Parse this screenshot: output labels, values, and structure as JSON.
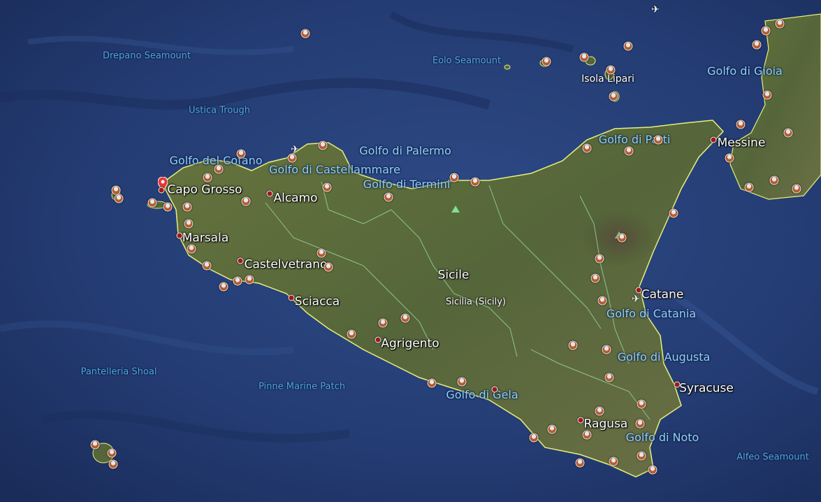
{
  "map": {
    "colors": {
      "sea": "#23386b",
      "land": "#5a6a38",
      "coast_line": "#e8f07a",
      "border_line": "#9ee3a8",
      "water_label": "#4fa9e8",
      "gulf_label": "#8fd2ff"
    },
    "labels": {
      "drepano_seamount": "Drepano Seamount",
      "eolo_seamount": "Eolo Seamount",
      "ustica_trough": "Ustica Trough",
      "golfo_del_cofano": "Golfo del Cofano",
      "golfo_di_palermo": "Golfo di Palermo",
      "golfo_di_castellammare": "Golfo di Castellammare",
      "golfo_di_termini": "Golfo di Termini",
      "golfo_di_gioia": "Golfo di Gioia",
      "golfo_di_patti": "Golfo di Patti",
      "isola_lipari": "Isola Lipari",
      "messine": "Messine",
      "capo_grosso": "Capo Grosso",
      "alcamo": "Alcamo",
      "marsala": "Marsala",
      "castelvetrano": "Castelvetrano",
      "sicile": "Sicile",
      "sicilia": "Sicilia (Sicily)",
      "catane": "Catane",
      "golfo_di_catania": "Golfo di Catania",
      "sciacca": "Sciacca",
      "agrigento": "Agrigento",
      "golfo_di_augusta": "Golfo di Augusta",
      "pantelleria_shoal": "Pantelleria Shoal",
      "pinne_marine_patch": "Pinne Marine Patch",
      "golfo_di_gela": "Golfo di Gela",
      "syracuse": "Syracuse",
      "ragusa": "Ragusa",
      "golfo_di_noto": "Golfo di Noto",
      "alfeo_seamount": "Alfeo Seamount"
    },
    "icons": {
      "location_pin": "red-map-pin-icon",
      "city_marker": "city-dot-icon",
      "photo_marker": "photo-icon",
      "airport": "airplane-icon",
      "volcano": "volcano-peak-icon"
    }
  }
}
